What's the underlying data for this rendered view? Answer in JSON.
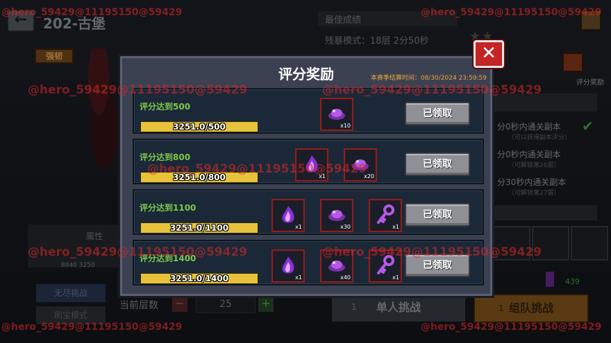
{
  "header": {
    "back_icon": "←",
    "stage_title": "202-古堡",
    "strengthen_label": "强韧"
  },
  "best_record": {
    "title": "最佳成绩",
    "cruel_mode": "残暴模式：18层 2分50秒"
  },
  "score_reward_label": "评分奖励",
  "requirements": [
    {
      "text": "分0秒内通关副本",
      "sub": "（可以获得副本评分）"
    },
    {
      "text": "分0秒内通关副本",
      "sub": "（可解锁第26层）"
    },
    {
      "text": "分30秒内通关副本",
      "sub": "（可解锁第27层）"
    }
  ],
  "resource_count": "439",
  "attributes": {
    "title": "属性",
    "values": "8840  3250"
  },
  "left_buttons": {
    "endless": "无尽挑战",
    "farm": "刷宝模式"
  },
  "floor": {
    "label": "当前层数",
    "value": "25",
    "minus": "−",
    "plus": "+"
  },
  "bottom_buttons": {
    "single_label": "单人挑战",
    "single_count": "1",
    "team_label": "组队挑战",
    "team_count": "1"
  },
  "modal": {
    "title": "评分奖励",
    "season_end": "本赛季结算时间：08/30/2024 23:59:59",
    "close_icon": "✕",
    "rows": [
      {
        "label": "评分达到500",
        "progress_text": "3251.0/500",
        "progress": 1.0,
        "button_label": "已领取",
        "items": [
          {
            "icon": "purple-ore-icon",
            "qty": "x10"
          }
        ]
      },
      {
        "label": "评分达到800",
        "progress_text": "3251.0/800",
        "progress": 1.0,
        "button_label": "已领取",
        "items": [
          {
            "icon": "purple-flame-icon",
            "qty": "x1"
          },
          {
            "icon": "purple-ore-icon",
            "qty": "x20"
          }
        ]
      },
      {
        "label": "评分达到1100",
        "progress_text": "3251.0/1100",
        "progress": 1.0,
        "button_label": "已领取",
        "items": [
          {
            "icon": "purple-flame-icon",
            "qty": "x1"
          },
          {
            "icon": "purple-ore-icon",
            "qty": "x30"
          },
          {
            "icon": "purple-key-icon",
            "qty": "x1"
          }
        ]
      },
      {
        "label": "评分达到1400",
        "progress_text": "3251.0/1400",
        "progress": 1.0,
        "button_label": "已领取",
        "items": [
          {
            "icon": "purple-flame-icon",
            "qty": "x1"
          },
          {
            "icon": "purple-ore-icon",
            "qty": "x40"
          },
          {
            "icon": "purple-key-icon",
            "qty": "x1"
          }
        ]
      }
    ]
  },
  "watermark": {
    "text_full": "@hero_59429@11195150@59429",
    "text_top_left": "@hero_59429@11195150@59429"
  },
  "colors": {
    "accent_green": "#7ec84a",
    "progress_yellow": "#e7c23a",
    "close_red": "#c42424",
    "season_orange": "#e8a43c",
    "watermark_red": "#dc2828"
  }
}
